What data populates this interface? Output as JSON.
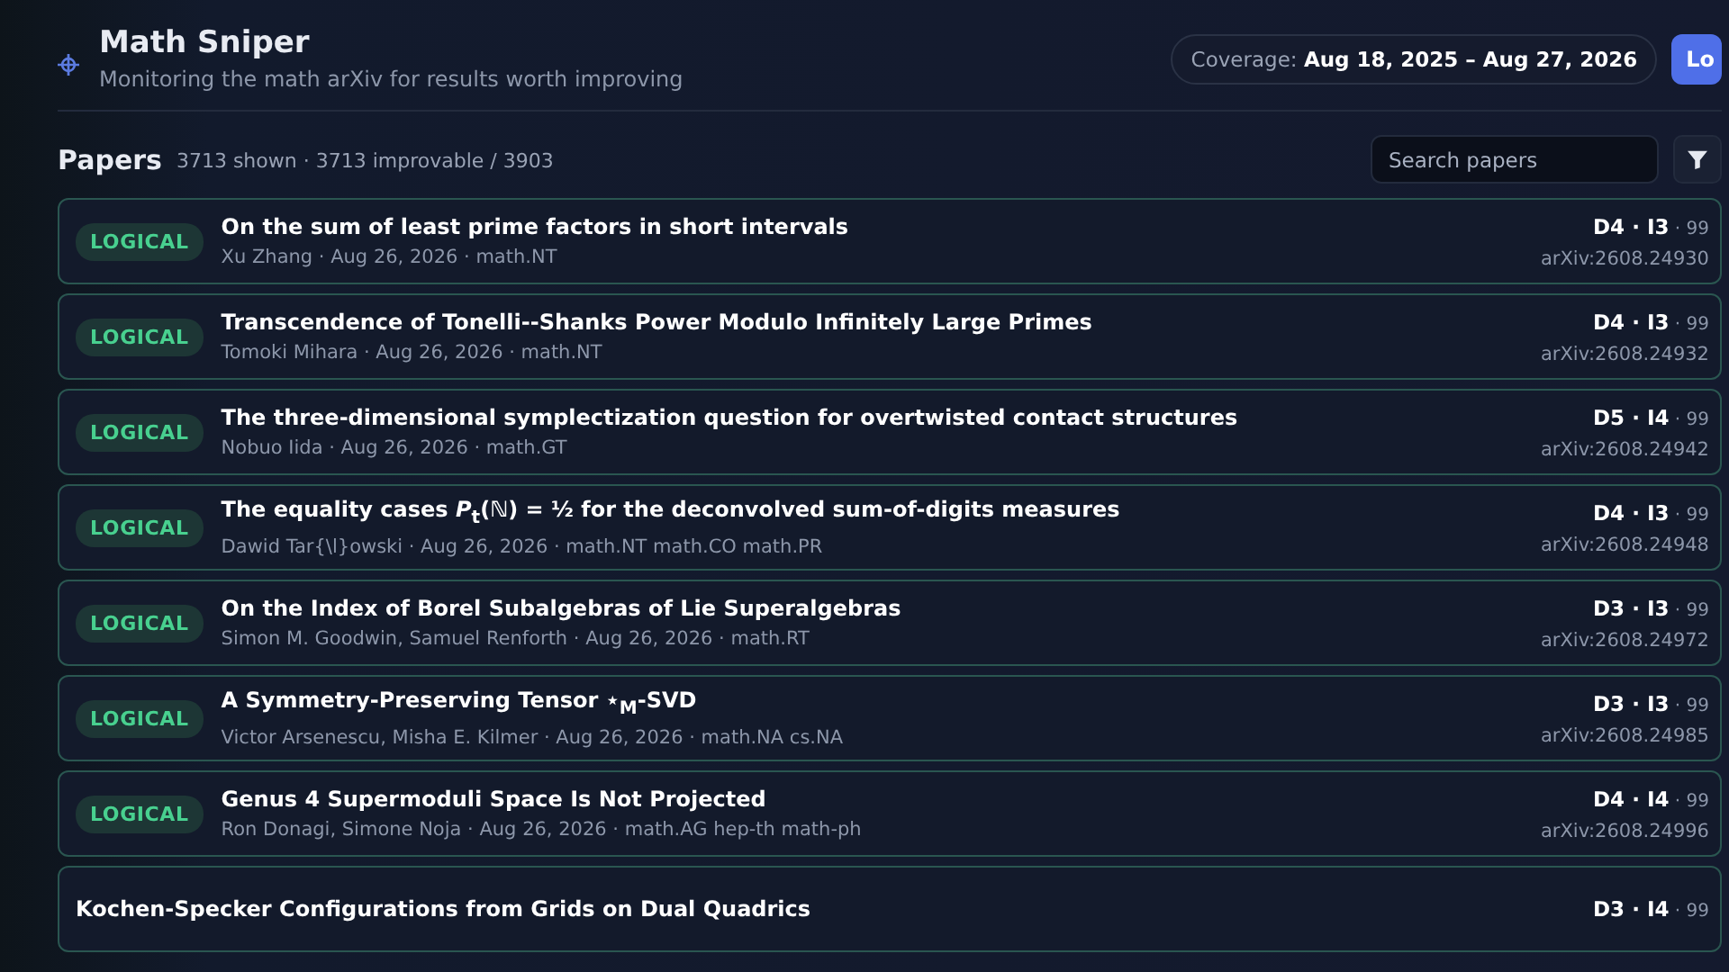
{
  "header": {
    "title": "Math Sniper",
    "subtitle": "Monitoring the math arXiv for results worth improving",
    "coverage": "Coverage: **Aug 18, 2025 – Aug 27, 2026**",
    "button": "Lo"
  },
  "papers": {
    "heading": "Papers",
    "stats": "3713 shown · 3713 improvable / 3903",
    "search": {
      "placeholder": "Search papers"
    },
    "rows": [
      {
        "badge": "LOGICAL",
        "title": "On the sum of least prime factors in short intervals",
        "meta": "Xu Zhang · Aug 26, 2026 · math.NT",
        "score": "**D4 · I3** · 99",
        "id": "arXiv:2608.24930"
      },
      {
        "badge": "LOGICAL",
        "title": "Transcendence of Tonelli--Shanks Power Modulo Infinitely Large Primes",
        "meta": "Tomoki Mihara · Aug 26, 2026 · math.NT",
        "score": "**D4 · I3** · 99",
        "id": "arXiv:2608.24932"
      },
      {
        "badge": "LOGICAL",
        "title": "The three-dimensional symplectization question for overtwisted contact structures",
        "meta": "Nobuo Iida · Aug 26, 2026 · math.GT",
        "score": "**D5 · I4** · 99",
        "id": "arXiv:2608.24942"
      },
      {
        "badge": "LOGICAL",
        "title": "The equality cases *P*$_{t}$(ℕ) = ½ for the deconvolved sum-of-digits measures",
        "meta": "Dawid Tar{\\l}owski · Aug 26, 2026 · math.NT math.CO math.PR",
        "score": "**D4 · I3** · 99",
        "id": "arXiv:2608.24948"
      },
      {
        "badge": "LOGICAL",
        "title": "On the Index of Borel Subalgebras of Lie Superalgebras",
        "meta": "Simon M. Goodwin, Samuel Renforth · Aug 26, 2026 · math.RT",
        "score": "**D3 · I3** · 99",
        "id": "arXiv:2608.24972"
      },
      {
        "badge": "LOGICAL",
        "title": "A Symmetry-Preserving Tensor ⋆$_{M}$-SVD",
        "meta": "Victor Arsenescu, Misha E. Kilmer · Aug 26, 2026 · math.NA cs.NA",
        "score": "**D3 · I3** · 99",
        "id": "arXiv:2608.24985"
      },
      {
        "badge": "LOGICAL",
        "title": "Genus 4 Supermoduli Space Is Not Projected",
        "meta": "Ron Donagi, Simone Noja · Aug 26, 2026 · math.AG hep-th math-ph",
        "score": "**D4 · I4** · 99",
        "id": "arXiv:2608.24996"
      },
      {
        "title": "Kochen-Specker Configurations from Grids on Dual Quadrics",
        "score": "**D3 · I4** · 99"
      }
    ]
  }
}
